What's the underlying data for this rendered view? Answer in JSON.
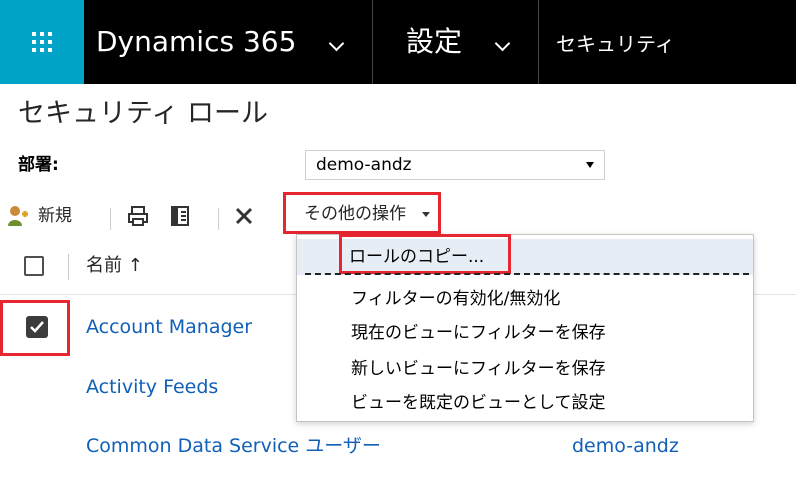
{
  "topbar": {
    "app_title": "Dynamics 365",
    "area_title": "設定",
    "breadcrumb": "セキュリティ"
  },
  "page": {
    "title": "セキュリティ ロール",
    "business_unit_label": "部署:",
    "business_unit_value": "demo-andz"
  },
  "toolbar": {
    "new_label": "新規",
    "more_actions_label": "その他の操作"
  },
  "grid": {
    "name_column": "名前 ↑",
    "rows": [
      {
        "name": "Account Manager",
        "business_unit": "",
        "checked": true
      },
      {
        "name": "Activity Feeds",
        "business_unit": "",
        "checked": false
      },
      {
        "name": "Common Data Service ユーザー",
        "business_unit": "demo-andz",
        "checked": false
      }
    ]
  },
  "menu": {
    "items": [
      "ロールのコピー...",
      "フィルターの有効化/無効化",
      "現在のビューにフィルターを保存",
      "新しいビューにフィルターを保存",
      "ビューを既定のビューとして設定"
    ]
  },
  "colors": {
    "accent": "#00a4c7",
    "link": "#1160b7",
    "highlight_box": "#e8262f",
    "topbar": "#000000"
  },
  "icons": {
    "waffle": "app-launcher-icon",
    "new": "new-role-icon",
    "print": "print-icon",
    "export": "export-icon",
    "delete": "delete-icon"
  }
}
